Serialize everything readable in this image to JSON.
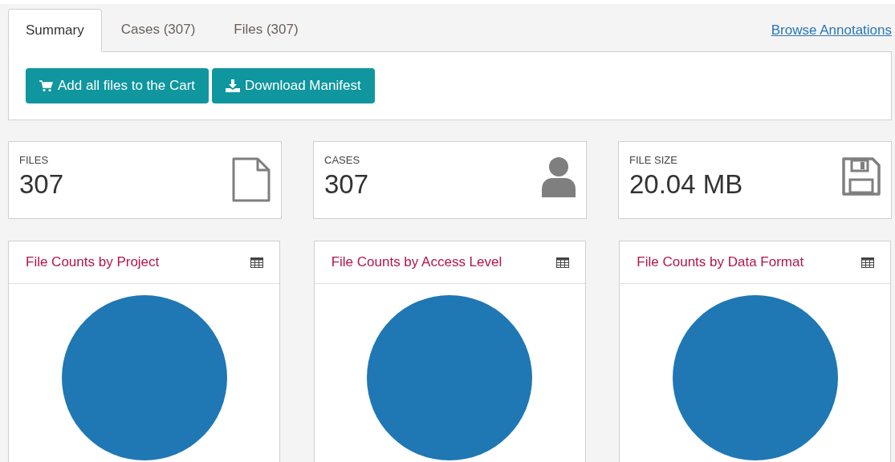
{
  "tabs": [
    {
      "label": "Summary",
      "selected": true
    },
    {
      "label": "Cases (307)",
      "selected": false
    },
    {
      "label": "Files (307)",
      "selected": false
    }
  ],
  "browse_link": "Browse Annotations",
  "buttons": [
    {
      "label": "Add all files to the Cart",
      "kind": "cart"
    },
    {
      "label": "Download Manifest",
      "kind": "download"
    }
  ],
  "stats": [
    {
      "label": "FILES",
      "value": "307",
      "kind": "file"
    },
    {
      "label": "CASES",
      "value": "307",
      "kind": "person"
    },
    {
      "label": "FILE SIZE",
      "value": "20.04 MB",
      "kind": "save"
    }
  ],
  "charts": [
    {
      "title": "File Counts by Project"
    },
    {
      "title": "File Counts by Access Level"
    },
    {
      "title": "File Counts by Data Format"
    }
  ]
}
